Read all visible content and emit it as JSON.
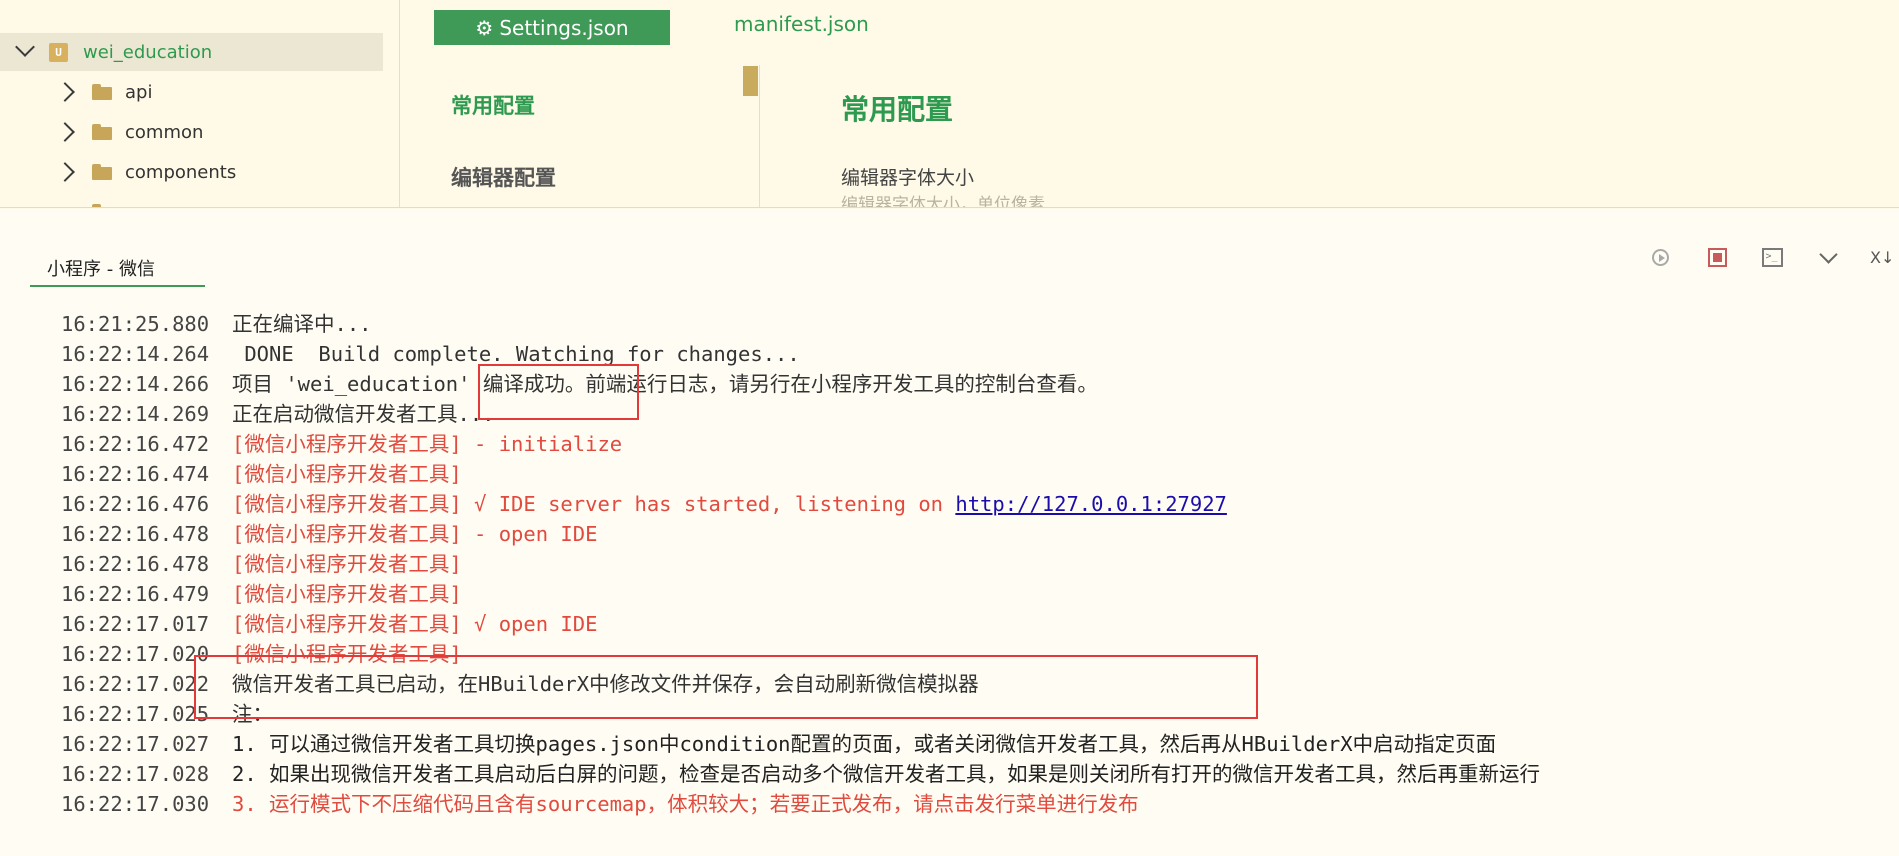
{
  "explorer": {
    "project": "wei_education",
    "folders": [
      "api",
      "common",
      "components"
    ]
  },
  "editor": {
    "tabs": {
      "active_label": "Settings.json",
      "inactive_label": "manifest.json"
    },
    "nav": {
      "current": "常用配置",
      "other": "编辑器配置"
    },
    "content": {
      "section_title": "常用配置",
      "setting_label": "编辑器字体大小",
      "setting_desc": "编辑器字体大小，单位像素"
    }
  },
  "console": {
    "tab_label": "小程序 - 微信",
    "tool_clear_label": "X↓",
    "lines": [
      {
        "ts": "16:21:25.880",
        "msg": "正在编译中..."
      },
      {
        "ts": "16:22:14.264",
        "msg": " DONE  Build complete. Watching for changes..."
      },
      {
        "ts": "16:22:14.266",
        "msg": "项目 'wei_education' 编译成功。前端运行日志，请另行在小程序开发工具的控制台查看。"
      },
      {
        "ts": "16:22:14.269",
        "msg": "正在启动微信开发者工具..."
      },
      {
        "ts": "16:22:16.472",
        "msg": "[微信小程序开发者工具] - initialize"
      },
      {
        "ts": "16:22:16.474",
        "msg": "[微信小程序开发者工具]"
      },
      {
        "ts": "16:22:16.476",
        "msg": "[微信小程序开发者工具] √ IDE server has started, listening on ",
        "link": "http://127.0.0.1:27927"
      },
      {
        "ts": "16:22:16.478",
        "msg": "[微信小程序开发者工具] - open IDE"
      },
      {
        "ts": "16:22:16.478",
        "msg": "[微信小程序开发者工具]"
      },
      {
        "ts": "16:22:16.479",
        "msg": "[微信小程序开发者工具]"
      },
      {
        "ts": "16:22:17.017",
        "msg": "[微信小程序开发者工具] √ open IDE"
      },
      {
        "ts": "16:22:17.020",
        "msg": "[微信小程序开发者工具]"
      },
      {
        "ts": "16:22:17.022",
        "msg": "微信开发者工具已启动，在HBuilderX中修改文件并保存，会自动刷新微信模拟器"
      },
      {
        "ts": "16:22:17.025",
        "msg": "注："
      },
      {
        "ts": "16:22:17.027",
        "msg": "1. 可以通过微信开发者工具切换pages.json中condition配置的页面，或者关闭微信开发者工具，然后再从HBuilderX中启动指定页面"
      },
      {
        "ts": "16:22:17.028",
        "msg": "2. 如果出现微信开发者工具启动后白屏的问题，检查是否启动多个微信开发者工具，如果是则关闭所有打开的微信开发者工具，然后再重新运行"
      },
      {
        "ts": "16:22:17.030",
        "msg": "3. 运行模式下不压缩代码且含有sourcemap，体积较大；若要正式发布，请点击发行菜单进行发布"
      }
    ]
  },
  "colors": {
    "accent_green": "#3e9a56",
    "log_red": "#e04a3f",
    "highlight_box": "#e23a3a",
    "background": "#fffae8"
  }
}
